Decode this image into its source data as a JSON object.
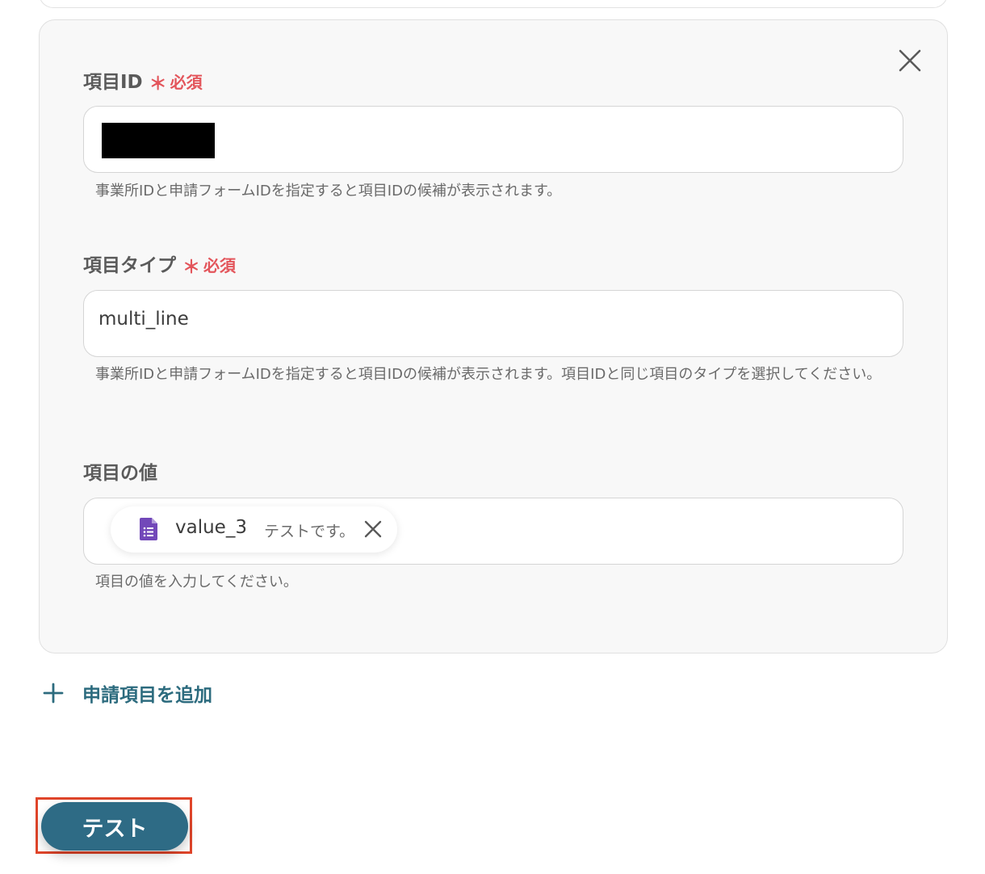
{
  "form": {
    "item_id": {
      "label": "項目ID",
      "required_mark": "＊",
      "required_text": "必須",
      "value": "",
      "help": "事業所IDと申請フォームIDを指定すると項目IDの候補が表示されます。"
    },
    "item_type": {
      "label": "項目タイプ",
      "required_mark": "＊",
      "required_text": "必須",
      "value": "multi_line",
      "help": "事業所IDと申請フォームIDを指定すると項目IDの候補が表示されます。項目IDと同じ項目のタイプを選択してください。"
    },
    "item_value": {
      "label": "項目の値",
      "chip": {
        "icon": "google-forms-icon",
        "name": "value_3",
        "value": "テストです。"
      },
      "help": "項目の値を入力してください。"
    }
  },
  "add_item": {
    "label": "申請項目を追加"
  },
  "test_button": {
    "label": "テスト"
  },
  "colors": {
    "required": "#e3555b",
    "accent": "#2c6b7e",
    "button": "#2e6b85",
    "highlight": "#e0452a",
    "forms_icon": "#7248b9"
  }
}
